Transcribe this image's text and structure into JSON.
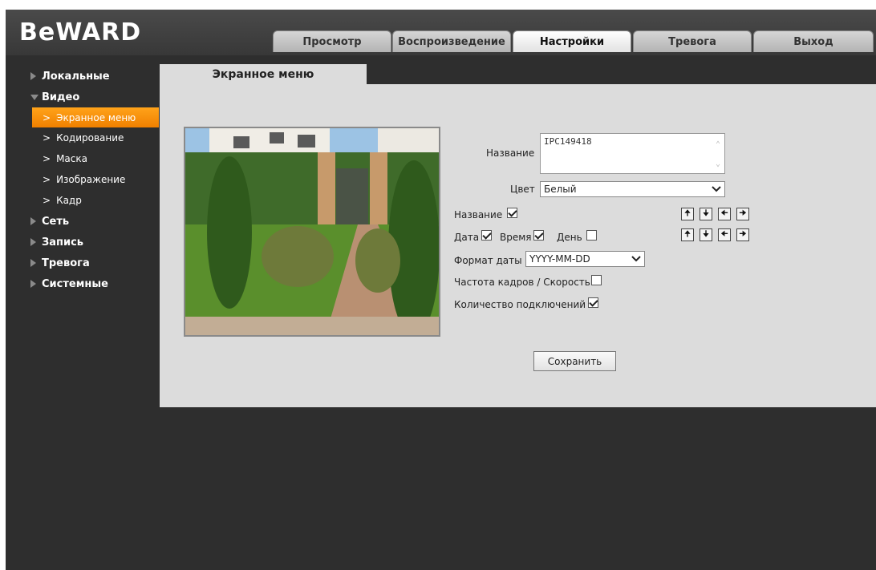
{
  "brand": {
    "logo": "BeWARD"
  },
  "nav": {
    "tabs": [
      {
        "label": "Просмотр",
        "active": false
      },
      {
        "label": "Воспроизведение",
        "active": false
      },
      {
        "label": "Настройки",
        "active": true
      },
      {
        "label": "Тревога",
        "active": false
      },
      {
        "label": "Выход",
        "active": false
      }
    ]
  },
  "sidebar": {
    "groups": [
      {
        "label": "Локальные",
        "expanded": false
      },
      {
        "label": "Видео",
        "expanded": true,
        "items": [
          {
            "label": "Экранное меню",
            "active": true
          },
          {
            "label": "Кодирование",
            "active": false
          },
          {
            "label": "Маска",
            "active": false
          },
          {
            "label": "Изображение",
            "active": false
          },
          {
            "label": "Кадр",
            "active": false
          }
        ]
      },
      {
        "label": "Сеть",
        "expanded": false
      },
      {
        "label": "Запись",
        "expanded": false
      },
      {
        "label": "Тревога",
        "expanded": false
      },
      {
        "label": "Системные",
        "expanded": false
      }
    ]
  },
  "page": {
    "tab_title": "Экранное меню",
    "form": {
      "name_label": "Название",
      "name_value": "IPC149418",
      "color_label": "Цвет",
      "color_value": "Белый",
      "show_name_label": "Название",
      "show_name_checked": true,
      "date_label": "Дата",
      "date_checked": true,
      "time_label": "Время",
      "time_checked": true,
      "day_label": "День",
      "day_checked": false,
      "date_format_label": "Формат даты",
      "date_format_value": "YYYY-MM-DD",
      "fps_label": "Частота кадров / Скорость",
      "fps_checked": false,
      "connections_label": "Количество подключений",
      "connections_checked": true,
      "save_label": "Сохранить"
    },
    "arrows": [
      "up-arrow-icon",
      "down-arrow-icon",
      "left-arrow-icon",
      "right-arrow-icon"
    ]
  },
  "colors": {
    "accent": "#f39000",
    "panel": "#dcdcdc",
    "background": "#2e2e2e"
  }
}
